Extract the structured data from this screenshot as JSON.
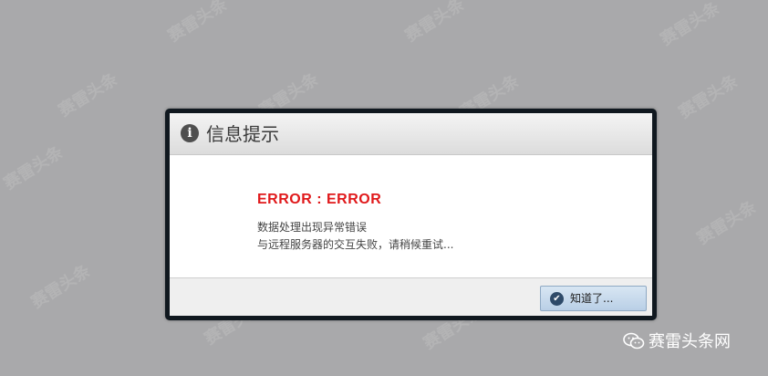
{
  "dialog": {
    "title": "信息提示",
    "icon": "info-icon",
    "error_title": "ERROR : ERROR",
    "message_lines": [
      "数据处理出现异常错误",
      "与远程服务器的交互失败，请稍候重试..."
    ],
    "ok_button": {
      "label": "知道了...",
      "icon": "check-icon"
    }
  },
  "overlay": {
    "watermark_text": "赛雷头条",
    "brand_text": "赛雷头条网",
    "brand_icon": "wechat-icon"
  },
  "colors": {
    "background": "#a9a9ab",
    "dialog_border": "#10181f",
    "error_text": "#e0191b",
    "button_bg": "#c9dbee"
  }
}
